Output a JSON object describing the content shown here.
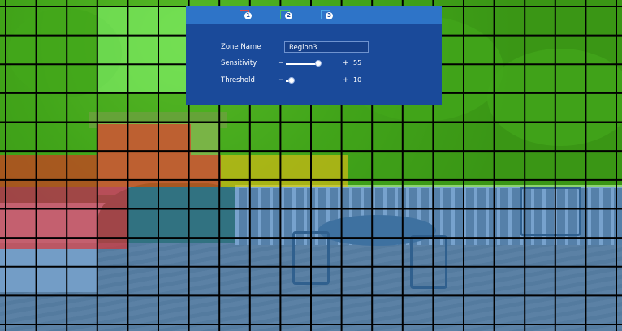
{
  "tabs": [
    {
      "number": "1",
      "color": "#e0504a"
    },
    {
      "number": "2",
      "color": "#49c06a"
    },
    {
      "number": "3",
      "color": "#4aa8e8"
    }
  ],
  "form": {
    "zone_name_label": "Zone Name",
    "zone_name_value": "Region3",
    "sensitivity_label": "Sensitivity",
    "sensitivity_value": "55",
    "threshold_label": "Threshold",
    "threshold_value": "10",
    "minus_glyph": "−",
    "plus_glyph": "+"
  },
  "slider_levels": {
    "sensitivity": 0.55,
    "threshold": 0.1
  },
  "grid": {
    "columns": 20,
    "rows": 11
  },
  "zone_colors": {
    "green": "rgba(70,200,20,0.55)",
    "light": "rgba(140,255,120,0.55)",
    "blue": "rgba(40,120,200,0.55)",
    "red": "rgba(235,40,35,0.6)",
    "yellow": "rgba(235,190,20,0.6)"
  },
  "colors": {
    "panel": "#1a4a9a",
    "panel_header": "#2e74c8",
    "grid_line": "#000000"
  }
}
